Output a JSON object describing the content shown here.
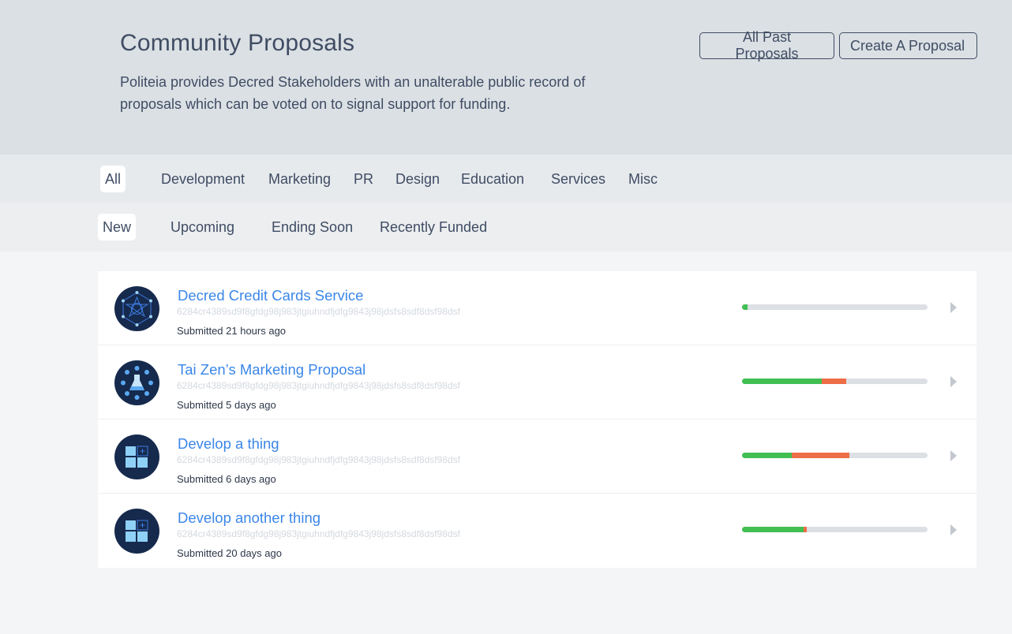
{
  "header": {
    "title": "Community Proposals",
    "description": "Politeia provides Decred Stakeholders with an unalterable public record of proposals which can be voted on to signal support for funding.",
    "buttons": {
      "past": "All Past Proposals",
      "create": "Create A Proposal"
    }
  },
  "categories": [
    "All",
    "Development",
    "Marketing",
    "PR",
    "Design",
    "Education",
    "Services",
    "Misc"
  ],
  "active_category": "All",
  "filters": [
    "New",
    "Upcoming",
    "Ending Soon",
    "Recently Funded"
  ],
  "active_filter": "New",
  "proposals": [
    {
      "title": "Decred Credit Cards Service",
      "hash": "6284cr4389sd9f8gfdg98j983jtgiuhndfjdfg9843j98jdsfs8sdf8dsf98dsf",
      "submitted": "Submitted 21 hours ago",
      "icon": "network-icon",
      "yes": 0.03,
      "no": 0.0
    },
    {
      "title": "Tai Zen’s Marketing Proposal",
      "hash": "6284cr4389sd9f8gfdg98j983jtgiuhndfjdfg9843j98jdsfs8sdf8dsf98dsf",
      "submitted": "Submitted 5 days ago",
      "icon": "flask-icon",
      "yes": 0.43,
      "no": 0.13
    },
    {
      "title": "Develop a thing",
      "hash": "6284cr4389sd9f8gfdg98j983jtgiuhndfjdfg9843j98jdsfs8sdf8dsf98dsf",
      "submitted": "Submitted 6 days ago",
      "icon": "blocks-icon",
      "yes": 0.27,
      "no": 0.31
    },
    {
      "title": "Develop another thing",
      "hash": "6284cr4389sd9f8gfdg98j983jtgiuhndfjdfg9843j98jdsfs8sdf8dsf98dsf",
      "submitted": "Submitted 20 days ago",
      "icon": "blocks-icon",
      "yes": 0.33,
      "no": 0.02
    }
  ],
  "colors": {
    "yes": "#41bf53",
    "no": "#ed6d47",
    "track": "#dcdfe3",
    "link": "#3b86e8",
    "avatar_bg": "#162a4d"
  }
}
